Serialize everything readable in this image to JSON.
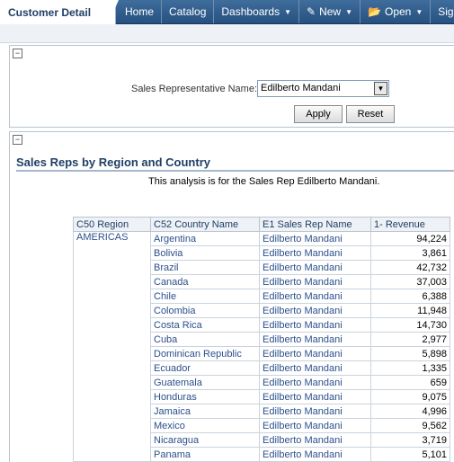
{
  "header": {
    "title": "Customer Detail",
    "nav": [
      {
        "label": "Home",
        "caret": false,
        "icon": ""
      },
      {
        "label": "Catalog",
        "caret": false,
        "icon": ""
      },
      {
        "label": "Dashboards",
        "caret": true,
        "icon": ""
      },
      {
        "label": "New",
        "caret": true,
        "icon": "new-icon"
      },
      {
        "label": "Open",
        "caret": true,
        "icon": "folder-icon"
      },
      {
        "label": "Signed",
        "caret": false,
        "icon": ""
      }
    ]
  },
  "prompt": {
    "label": "Sales Representative Name:",
    "selected": "Edilberto Mandani",
    "apply_label": "Apply",
    "reset_label": "Reset"
  },
  "report": {
    "title": "Sales Reps by Region and Country",
    "subtitle": "This analysis is for the Sales Rep Edilberto Mandani.",
    "columns": [
      "C50 Region",
      "C52 Country Name",
      "E1 Sales Rep Name",
      "1- Revenue"
    ],
    "region": "AMERICAS",
    "rows": [
      {
        "country": "Argentina",
        "rep": "Edilberto Mandani",
        "revenue": "94,224"
      },
      {
        "country": "Bolivia",
        "rep": "Edilberto Mandani",
        "revenue": "3,861"
      },
      {
        "country": "Brazil",
        "rep": "Edilberto Mandani",
        "revenue": "42,732"
      },
      {
        "country": "Canada",
        "rep": "Edilberto Mandani",
        "revenue": "37,003"
      },
      {
        "country": "Chile",
        "rep": "Edilberto Mandani",
        "revenue": "6,388"
      },
      {
        "country": "Colombia",
        "rep": "Edilberto Mandani",
        "revenue": "11,948"
      },
      {
        "country": "Costa Rica",
        "rep": "Edilberto Mandani",
        "revenue": "14,730"
      },
      {
        "country": "Cuba",
        "rep": "Edilberto Mandani",
        "revenue": "2,977"
      },
      {
        "country": "Dominican Republic",
        "rep": "Edilberto Mandani",
        "revenue": "5,898"
      },
      {
        "country": "Ecuador",
        "rep": "Edilberto Mandani",
        "revenue": "1,335"
      },
      {
        "country": "Guatemala",
        "rep": "Edilberto Mandani",
        "revenue": "659"
      },
      {
        "country": "Honduras",
        "rep": "Edilberto Mandani",
        "revenue": "9,075"
      },
      {
        "country": "Jamaica",
        "rep": "Edilberto Mandani",
        "revenue": "4,996"
      },
      {
        "country": "Mexico",
        "rep": "Edilberto Mandani",
        "revenue": "9,562"
      },
      {
        "country": "Nicaragua",
        "rep": "Edilberto Mandani",
        "revenue": "3,719"
      },
      {
        "country": "Panama",
        "rep": "Edilberto Mandani",
        "revenue": "5,101"
      }
    ]
  }
}
